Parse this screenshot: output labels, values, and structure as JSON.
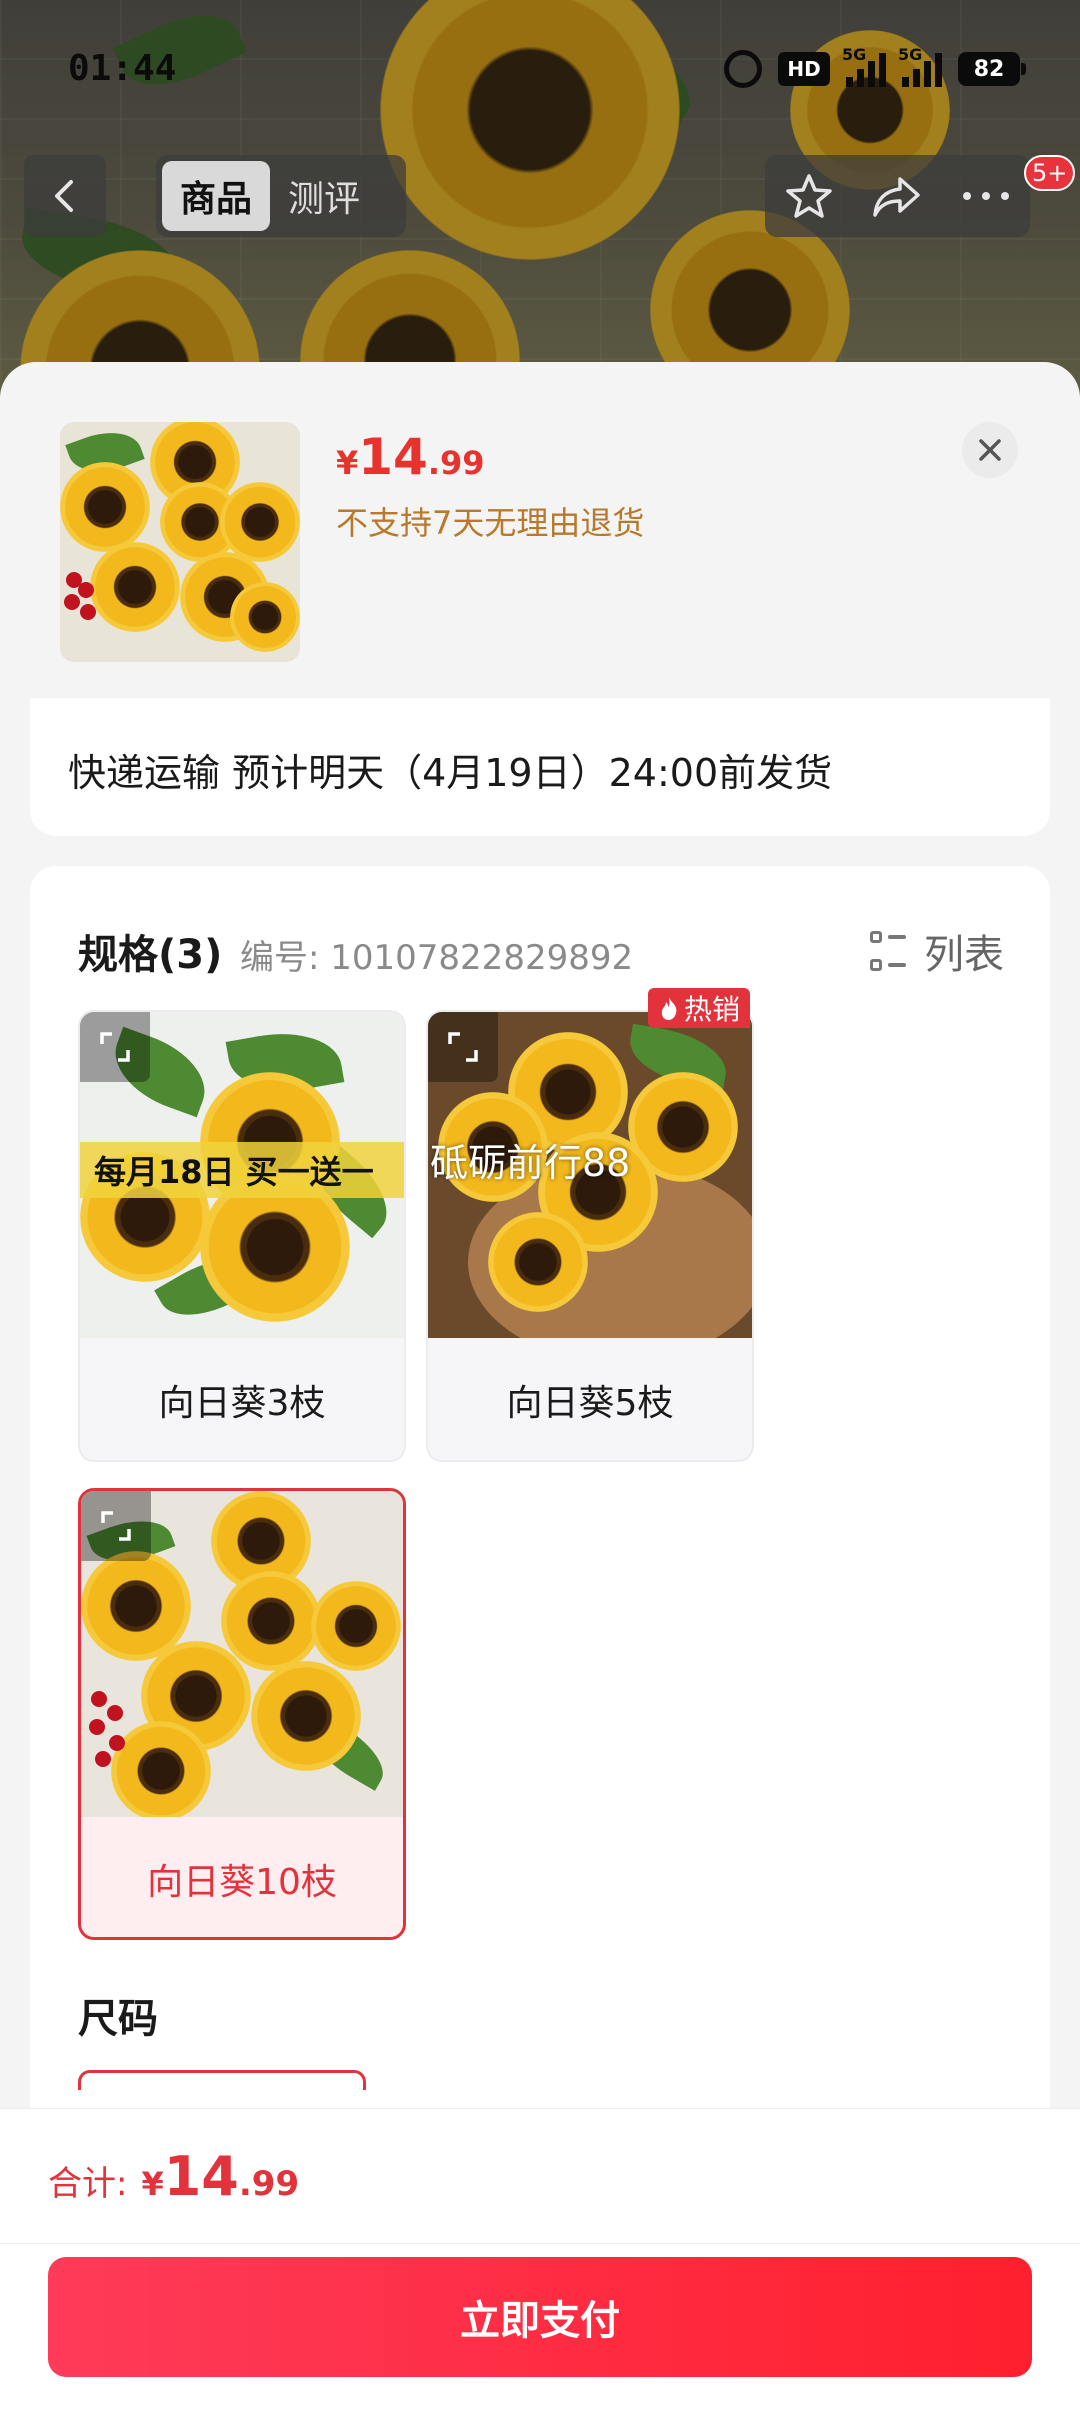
{
  "status_bar": {
    "time": "01:44",
    "hd_label": "HD",
    "signal_1_label": "5G",
    "signal_2_label": "5G",
    "battery": "82"
  },
  "top_nav": {
    "tabs": [
      {
        "label": "商品",
        "active": true
      },
      {
        "label": "测评",
        "active": false
      }
    ],
    "icons": [
      "back-arrow-icon",
      "star-icon",
      "share-icon",
      "more-icon"
    ],
    "badge": "5+"
  },
  "sheet": {
    "price": {
      "symbol": "¥",
      "integer": "14",
      "decimal": ".99"
    },
    "return_note": "不支持7天无理由退货",
    "shipping": "快递运输 预计明天（4月19日）24:00前发货",
    "spec": {
      "title": "规格(3)",
      "code": "编号: 10107822829892",
      "list_toggle": "列表",
      "options": [
        {
          "label": "向日葵3枝",
          "promo": "每月18日 买一送一",
          "selected": false
        },
        {
          "label": "向日葵5枝",
          "hot_tag": "热销",
          "selected": false
        },
        {
          "label": "向日葵10枝",
          "selected": true
        }
      ],
      "watermark": "砥砺前行88"
    },
    "size_title": "尺码"
  },
  "bottom": {
    "total_label": "合计:",
    "total": {
      "symbol": "¥",
      "integer": "14",
      "decimal": ".99"
    },
    "pay_button": "立即支付"
  },
  "colors": {
    "accent": "#e2323c",
    "return_note": "#b8792a"
  }
}
